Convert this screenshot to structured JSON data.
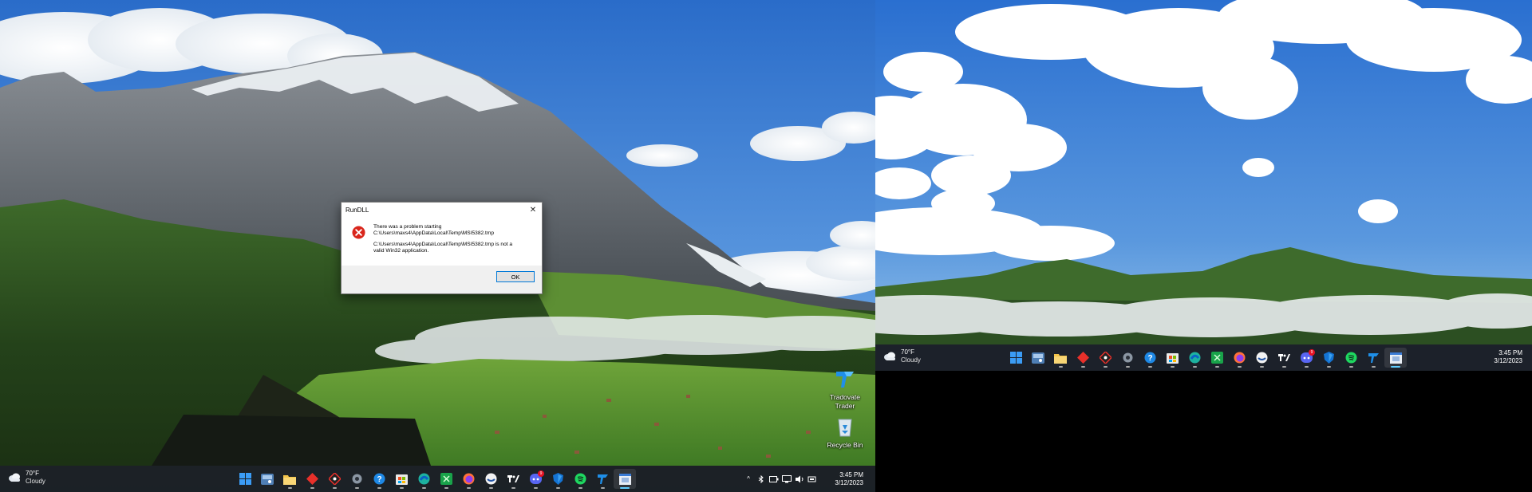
{
  "desktop_icons": [
    {
      "label_line1": "Tradovate",
      "label_line2": "Trader",
      "icon": "tradovate-icon"
    },
    {
      "label_line1": "Recycle Bin",
      "icon": "recycle-bin-icon"
    }
  ],
  "dialog": {
    "title": "RunDLL",
    "close_glyph": "✕",
    "message_line1": "There was a problem starting",
    "message_line2": "C:\\Users\\mavs4\\AppData\\Local\\Temp\\MSI5382.tmp",
    "message_line3": "C:\\Users\\mavs4\\AppData\\Local\\Temp\\MSI5382.tmp is not a",
    "message_line4": "valid Win32 application.",
    "ok_label": "OK",
    "icon": "error-icon"
  },
  "weather": {
    "temp": "70°F",
    "condition": "Cloudy"
  },
  "taskbar_apps": [
    {
      "name": "start",
      "icon": "windows-start-icon"
    },
    {
      "name": "widgets",
      "icon": "widgets-icon"
    },
    {
      "name": "file-explorer",
      "icon": "folder-icon"
    },
    {
      "name": "red-app",
      "icon": "red-diamond-icon"
    },
    {
      "name": "diamond-app",
      "icon": "diamond-outline-icon"
    },
    {
      "name": "settings",
      "icon": "gear-icon"
    },
    {
      "name": "help",
      "icon": "help-icon"
    },
    {
      "name": "store",
      "icon": "store-icon"
    },
    {
      "name": "edge",
      "icon": "edge-icon"
    },
    {
      "name": "green-app",
      "icon": "green-app-icon"
    },
    {
      "name": "firefox",
      "icon": "firefox-icon"
    },
    {
      "name": "white-circle-app",
      "icon": "circle-app-icon"
    },
    {
      "name": "tradingview",
      "icon": "tradingview-icon"
    },
    {
      "name": "discord",
      "icon": "discord-icon",
      "badge": "9"
    },
    {
      "name": "defender",
      "icon": "shield-icon"
    },
    {
      "name": "spotify",
      "icon": "spotify-icon"
    },
    {
      "name": "tradovate",
      "icon": "tradovate-icon"
    },
    {
      "name": "active-window",
      "icon": "window-icon"
    }
  ],
  "tray": {
    "chevron": "^",
    "time": "3:45 PM",
    "date": "3/12/2023"
  },
  "colors": {
    "taskbar": "#1c2028",
    "accent": "#60cdff",
    "error_red": "#d9261c",
    "dialog_border": "#0078d7"
  }
}
